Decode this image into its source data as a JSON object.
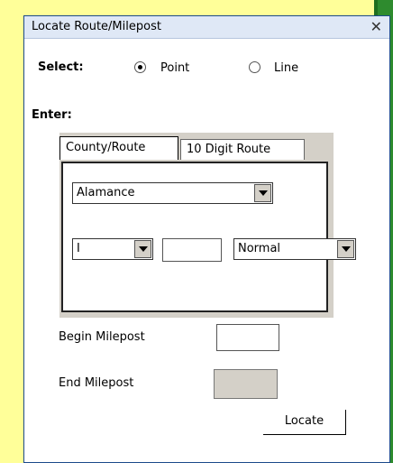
{
  "window": {
    "title": "Locate Route/Milepost",
    "close_glyph": "✕"
  },
  "select": {
    "label": "Select:",
    "options": [
      {
        "label": "Point",
        "selected": true
      },
      {
        "label": "Line",
        "selected": false
      }
    ]
  },
  "enter": {
    "label": "Enter:",
    "tabs": [
      {
        "label": "County/Route",
        "active": true
      },
      {
        "label": "10 Digit Route",
        "active": false
      }
    ],
    "county": {
      "value": "Alamance"
    },
    "route_type": {
      "value": "I"
    },
    "route_number": {
      "value": ""
    },
    "route_modifier": {
      "value": "Normal"
    }
  },
  "milepost": {
    "begin_label": "Begin Milepost",
    "begin_value": "",
    "end_label": "End Milepost",
    "end_value": ""
  },
  "actions": {
    "locate_label": "Locate"
  },
  "colors": {
    "background": "#ffff99",
    "accent_green": "#2e8b2e",
    "titlebar": "#dfe8f6",
    "panel_gray": "#d4d0c8"
  }
}
